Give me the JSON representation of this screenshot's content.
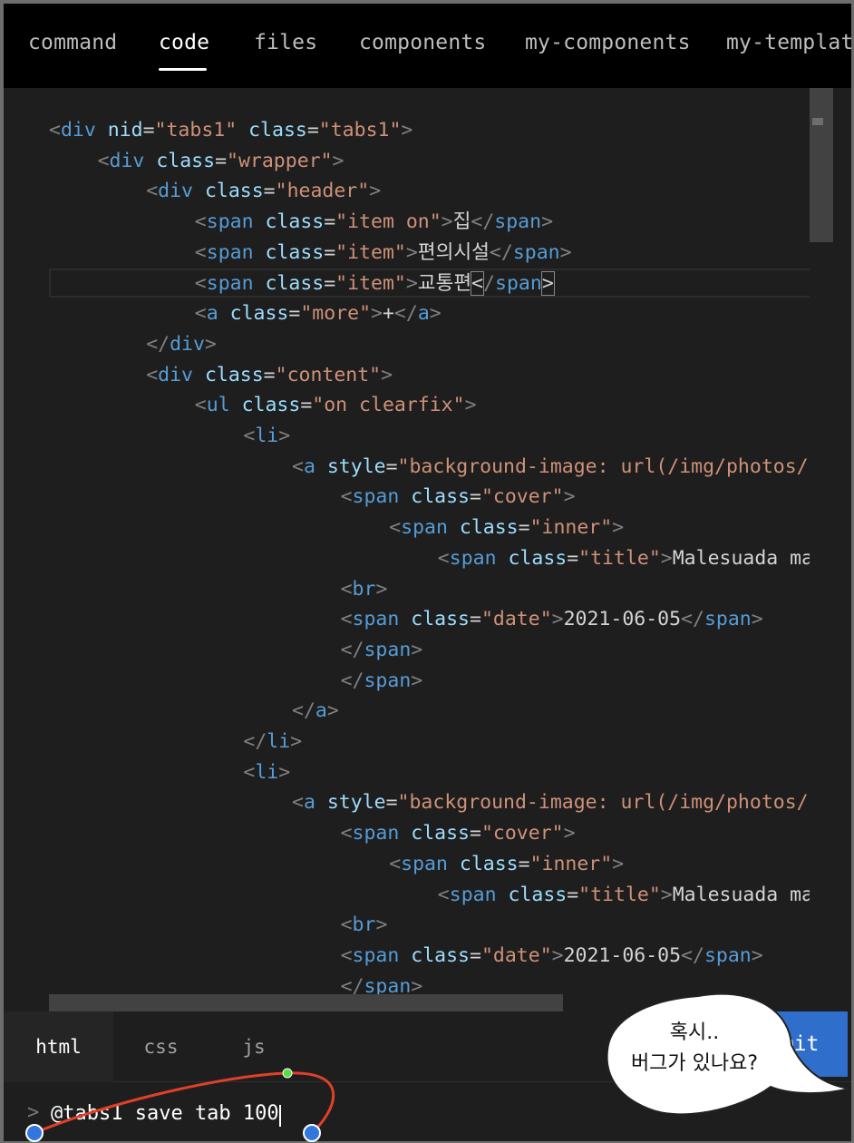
{
  "top_tabs": [
    {
      "label": "command",
      "active": false
    },
    {
      "label": "code",
      "active": true
    },
    {
      "label": "files",
      "active": false
    },
    {
      "label": "components",
      "active": false
    },
    {
      "label": "my-components",
      "active": false
    },
    {
      "label": "my-template",
      "active": false
    }
  ],
  "editor": {
    "lines": [
      {
        "indent": 0,
        "tokens": [
          [
            "punc",
            "<"
          ],
          [
            "tag",
            "div"
          ],
          [
            "text",
            " "
          ],
          [
            "attr",
            "nid"
          ],
          [
            "eq",
            "="
          ],
          [
            "str",
            "\"tabs1\""
          ],
          [
            "text",
            " "
          ],
          [
            "attr",
            "class"
          ],
          [
            "eq",
            "="
          ],
          [
            "str",
            "\"tabs1\""
          ],
          [
            "punc",
            ">"
          ]
        ]
      },
      {
        "indent": 4,
        "tokens": [
          [
            "punc",
            "<"
          ],
          [
            "tag",
            "div"
          ],
          [
            "text",
            " "
          ],
          [
            "attr",
            "class"
          ],
          [
            "eq",
            "="
          ],
          [
            "str",
            "\"wrapper\""
          ],
          [
            "punc",
            ">"
          ]
        ]
      },
      {
        "indent": 8,
        "tokens": [
          [
            "punc",
            "<"
          ],
          [
            "tag",
            "div"
          ],
          [
            "text",
            " "
          ],
          [
            "attr",
            "class"
          ],
          [
            "eq",
            "="
          ],
          [
            "str",
            "\"header\""
          ],
          [
            "punc",
            ">"
          ]
        ]
      },
      {
        "indent": 12,
        "tokens": [
          [
            "punc",
            "<"
          ],
          [
            "tag",
            "span"
          ],
          [
            "text",
            " "
          ],
          [
            "attr",
            "class"
          ],
          [
            "eq",
            "="
          ],
          [
            "str",
            "\"item on\""
          ],
          [
            "punc",
            ">"
          ],
          [
            "text",
            "집"
          ],
          [
            "punc",
            "</"
          ],
          [
            "tag",
            "span"
          ],
          [
            "punc",
            ">"
          ]
        ]
      },
      {
        "indent": 12,
        "tokens": [
          [
            "punc",
            "<"
          ],
          [
            "tag",
            "span"
          ],
          [
            "text",
            " "
          ],
          [
            "attr",
            "class"
          ],
          [
            "eq",
            "="
          ],
          [
            "str",
            "\"item\""
          ],
          [
            "punc",
            ">"
          ],
          [
            "text",
            "편의시설"
          ],
          [
            "punc",
            "</"
          ],
          [
            "tag",
            "span"
          ],
          [
            "punc",
            ">"
          ]
        ]
      },
      {
        "indent": 12,
        "tokens": [
          [
            "punc",
            "<"
          ],
          [
            "tag",
            "span"
          ],
          [
            "text",
            " "
          ],
          [
            "attr",
            "class"
          ],
          [
            "eq",
            "="
          ],
          [
            "str",
            "\"item\""
          ],
          [
            "punc",
            ">"
          ],
          [
            "text",
            "교통편"
          ],
          [
            "bracket",
            "<"
          ],
          [
            "punc",
            "/"
          ],
          [
            "tag",
            "span"
          ],
          [
            "bracket",
            ">"
          ]
        ]
      },
      {
        "indent": 12,
        "tokens": [
          [
            "punc",
            "<"
          ],
          [
            "tag",
            "a"
          ],
          [
            "text",
            " "
          ],
          [
            "attr",
            "class"
          ],
          [
            "eq",
            "="
          ],
          [
            "str",
            "\"more\""
          ],
          [
            "punc",
            ">"
          ],
          [
            "text",
            "+"
          ],
          [
            "punc",
            "</"
          ],
          [
            "tag",
            "a"
          ],
          [
            "punc",
            ">"
          ]
        ]
      },
      {
        "indent": 8,
        "tokens": [
          [
            "punc",
            "</"
          ],
          [
            "tag",
            "div"
          ],
          [
            "punc",
            ">"
          ]
        ]
      },
      {
        "indent": 8,
        "tokens": [
          [
            "punc",
            "<"
          ],
          [
            "tag",
            "div"
          ],
          [
            "text",
            " "
          ],
          [
            "attr",
            "class"
          ],
          [
            "eq",
            "="
          ],
          [
            "str",
            "\"content\""
          ],
          [
            "punc",
            ">"
          ]
        ]
      },
      {
        "indent": 12,
        "tokens": [
          [
            "punc",
            "<"
          ],
          [
            "tag",
            "ul"
          ],
          [
            "text",
            " "
          ],
          [
            "attr",
            "class"
          ],
          [
            "eq",
            "="
          ],
          [
            "str",
            "\"on clearfix\""
          ],
          [
            "punc",
            ">"
          ]
        ]
      },
      {
        "indent": 16,
        "tokens": [
          [
            "punc",
            "<"
          ],
          [
            "tag",
            "li"
          ],
          [
            "punc",
            ">"
          ]
        ]
      },
      {
        "indent": 20,
        "tokens": [
          [
            "punc",
            "<"
          ],
          [
            "tag",
            "a"
          ],
          [
            "text",
            " "
          ],
          [
            "attr",
            "style"
          ],
          [
            "eq",
            "="
          ],
          [
            "str",
            "\"background-image: url(/img/photos/g"
          ]
        ]
      },
      {
        "indent": 24,
        "tokens": [
          [
            "punc",
            "<"
          ],
          [
            "tag",
            "span"
          ],
          [
            "text",
            " "
          ],
          [
            "attr",
            "class"
          ],
          [
            "eq",
            "="
          ],
          [
            "str",
            "\"cover\""
          ],
          [
            "punc",
            ">"
          ]
        ]
      },
      {
        "indent": 28,
        "tokens": [
          [
            "punc",
            "<"
          ],
          [
            "tag",
            "span"
          ],
          [
            "text",
            " "
          ],
          [
            "attr",
            "class"
          ],
          [
            "eq",
            "="
          ],
          [
            "str",
            "\"inner\""
          ],
          [
            "punc",
            ">"
          ]
        ]
      },
      {
        "indent": 32,
        "tokens": [
          [
            "punc",
            "<"
          ],
          [
            "tag",
            "span"
          ],
          [
            "text",
            " "
          ],
          [
            "attr",
            "class"
          ],
          [
            "eq",
            "="
          ],
          [
            "str",
            "\"title\""
          ],
          [
            "punc",
            ">"
          ],
          [
            "text",
            "Malesuada mag"
          ]
        ]
      },
      {
        "indent": 24,
        "tokens": [
          [
            "punc",
            "<"
          ],
          [
            "tag",
            "br"
          ],
          [
            "punc",
            ">"
          ]
        ]
      },
      {
        "indent": 24,
        "tokens": [
          [
            "punc",
            "<"
          ],
          [
            "tag",
            "span"
          ],
          [
            "text",
            " "
          ],
          [
            "attr",
            "class"
          ],
          [
            "eq",
            "="
          ],
          [
            "str",
            "\"date\""
          ],
          [
            "punc",
            ">"
          ],
          [
            "text",
            "2021-06-05"
          ],
          [
            "punc",
            "</"
          ],
          [
            "tag",
            "span"
          ],
          [
            "punc",
            ">"
          ]
        ]
      },
      {
        "indent": 24,
        "tokens": [
          [
            "punc",
            "</"
          ],
          [
            "tag",
            "span"
          ],
          [
            "punc",
            ">"
          ]
        ]
      },
      {
        "indent": 24,
        "tokens": [
          [
            "punc",
            "</"
          ],
          [
            "tag",
            "span"
          ],
          [
            "punc",
            ">"
          ]
        ]
      },
      {
        "indent": 20,
        "tokens": [
          [
            "punc",
            "</"
          ],
          [
            "tag",
            "a"
          ],
          [
            "punc",
            ">"
          ]
        ]
      },
      {
        "indent": 16,
        "tokens": [
          [
            "punc",
            "</"
          ],
          [
            "tag",
            "li"
          ],
          [
            "punc",
            ">"
          ]
        ]
      },
      {
        "indent": 16,
        "tokens": [
          [
            "punc",
            "<"
          ],
          [
            "tag",
            "li"
          ],
          [
            "punc",
            ">"
          ]
        ]
      },
      {
        "indent": 20,
        "tokens": [
          [
            "punc",
            "<"
          ],
          [
            "tag",
            "a"
          ],
          [
            "text",
            " "
          ],
          [
            "attr",
            "style"
          ],
          [
            "eq",
            "="
          ],
          [
            "str",
            "\"background-image: url(/img/photos/i"
          ]
        ]
      },
      {
        "indent": 24,
        "tokens": [
          [
            "punc",
            "<"
          ],
          [
            "tag",
            "span"
          ],
          [
            "text",
            " "
          ],
          [
            "attr",
            "class"
          ],
          [
            "eq",
            "="
          ],
          [
            "str",
            "\"cover\""
          ],
          [
            "punc",
            ">"
          ]
        ]
      },
      {
        "indent": 28,
        "tokens": [
          [
            "punc",
            "<"
          ],
          [
            "tag",
            "span"
          ],
          [
            "text",
            " "
          ],
          [
            "attr",
            "class"
          ],
          [
            "eq",
            "="
          ],
          [
            "str",
            "\"inner\""
          ],
          [
            "punc",
            ">"
          ]
        ]
      },
      {
        "indent": 32,
        "tokens": [
          [
            "punc",
            "<"
          ],
          [
            "tag",
            "span"
          ],
          [
            "text",
            " "
          ],
          [
            "attr",
            "class"
          ],
          [
            "eq",
            "="
          ],
          [
            "str",
            "\"title\""
          ],
          [
            "punc",
            ">"
          ],
          [
            "text",
            "Malesuada mag"
          ]
        ]
      },
      {
        "indent": 24,
        "tokens": [
          [
            "punc",
            "<"
          ],
          [
            "tag",
            "br"
          ],
          [
            "punc",
            ">"
          ]
        ]
      },
      {
        "indent": 24,
        "tokens": [
          [
            "punc",
            "<"
          ],
          [
            "tag",
            "span"
          ],
          [
            "text",
            " "
          ],
          [
            "attr",
            "class"
          ],
          [
            "eq",
            "="
          ],
          [
            "str",
            "\"date\""
          ],
          [
            "punc",
            ">"
          ],
          [
            "text",
            "2021-06-05"
          ],
          [
            "punc",
            "</"
          ],
          [
            "tag",
            "span"
          ],
          [
            "punc",
            ">"
          ]
        ]
      },
      {
        "indent": 24,
        "tokens": [
          [
            "punc",
            "</"
          ],
          [
            "tag",
            "span"
          ],
          [
            "punc",
            ">"
          ]
        ]
      },
      {
        "indent": 24,
        "tokens": [
          [
            "punc",
            "</"
          ],
          [
            "tag",
            "span"
          ],
          [
            "punc",
            ">"
          ]
        ]
      }
    ]
  },
  "bottom_tabs": [
    {
      "label": "html",
      "active": true
    },
    {
      "label": "css",
      "active": false
    },
    {
      "label": "js",
      "active": false
    }
  ],
  "submit_label": "bmit",
  "command": {
    "prompt": ">",
    "value": "@tabs1 save tab 100"
  },
  "annotation": {
    "bubble_line1": "혹시..",
    "bubble_line2": "버그가 있나요?"
  }
}
